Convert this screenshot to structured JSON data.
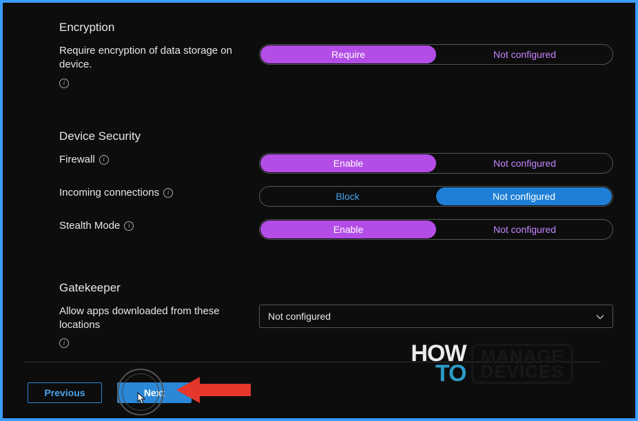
{
  "sections": {
    "encryption": {
      "title": "Encryption",
      "storage": {
        "label": "Require encryption of data storage on device.",
        "opt_on": "Require",
        "opt_off": "Not configured",
        "selected": "on"
      }
    },
    "device_security": {
      "title": "Device Security",
      "firewall": {
        "label": "Firewall",
        "opt_on": "Enable",
        "opt_off": "Not configured",
        "selected": "on"
      },
      "incoming": {
        "label": "Incoming connections",
        "opt_on": "Block",
        "opt_off": "Not configured",
        "selected": "off"
      },
      "stealth": {
        "label": "Stealth Mode",
        "opt_on": "Enable",
        "opt_off": "Not configured",
        "selected": "on"
      }
    },
    "gatekeeper": {
      "title": "Gatekeeper",
      "allow_apps": {
        "label": "Allow apps downloaded from these locations",
        "value": "Not configured"
      }
    }
  },
  "footer": {
    "previous": "Previous",
    "next": "Next"
  },
  "watermark": {
    "line1a": "HOW",
    "line1b": "TO",
    "line2a": "MANAGE",
    "line2b": "DEVICES"
  }
}
